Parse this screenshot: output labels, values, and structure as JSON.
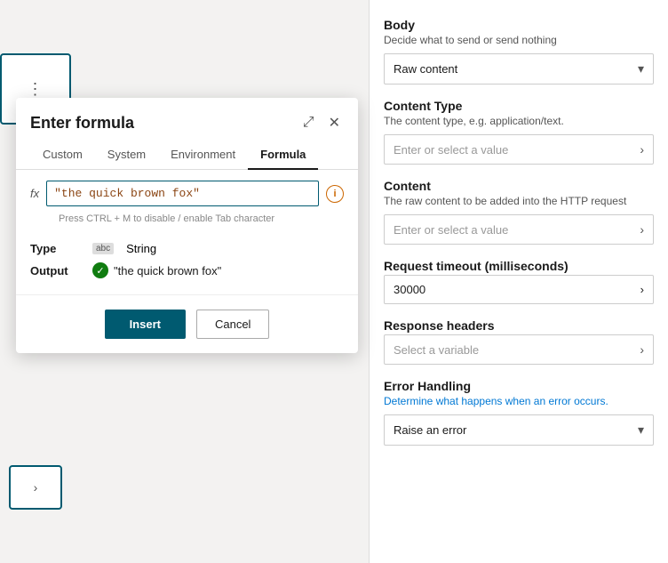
{
  "dialog": {
    "title": "Enter formula",
    "tabs": [
      "Custom",
      "System",
      "Environment",
      "Formula"
    ],
    "active_tab": "Formula",
    "fx_label": "fx",
    "formula_value": "\"the quick brown fox\"",
    "ctrl_hint": "Press CTRL + M to disable / enable Tab character",
    "type_label": "Type",
    "type_value": "String",
    "output_label": "Output",
    "output_value": "\"the quick brown fox\"",
    "insert_label": "Insert",
    "cancel_label": "Cancel",
    "info_icon": "i",
    "expand_icon": "⤢",
    "close_icon": "✕"
  },
  "right_panel": {
    "body": {
      "title": "Body",
      "subtitle": "Decide what to send or send nothing",
      "selected": "Raw content",
      "chevron": "▾"
    },
    "content_type": {
      "title": "Content Type",
      "subtitle": "The content type, e.g. application/text.",
      "placeholder": "Enter or select a value",
      "chevron": "›"
    },
    "content": {
      "title": "Content",
      "subtitle": "The raw content to be added into the HTTP request",
      "placeholder": "Enter or select a value",
      "chevron": "›"
    },
    "request_timeout": {
      "title": "Request timeout (milliseconds)",
      "value": "30000",
      "chevron": "›"
    },
    "response_headers": {
      "title": "Response headers",
      "placeholder": "Select a variable",
      "chevron": "›"
    },
    "error_handling": {
      "title": "Error Handling",
      "subtitle": "Determine what happens when an error occurs.",
      "selected": "Raise an error",
      "chevron": "▾"
    }
  },
  "canvas": {
    "dots": "⋮",
    "arrow": "›"
  }
}
